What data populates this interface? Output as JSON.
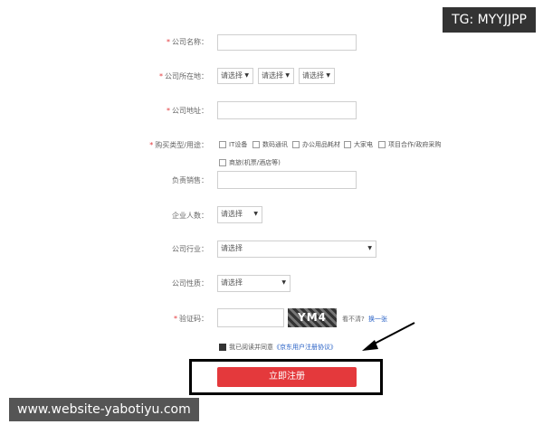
{
  "form": {
    "company_name": {
      "label": "公司名称：",
      "required": true
    },
    "company_location": {
      "label": "公司所在地：",
      "required": true,
      "selects": [
        "请选择",
        "请选择",
        "请选择"
      ]
    },
    "company_address": {
      "label": "公司地址：",
      "required": true
    },
    "purchase_type": {
      "label": "购买类型/用途：",
      "required": true,
      "options": [
        "IT设备",
        "数码通讯",
        "办公用品耗材",
        "大家电",
        "项目合作/政府采购",
        "商旅(机票/酒店等)"
      ]
    },
    "sales_rep": {
      "label": "负责销售：",
      "required": false
    },
    "employee_count": {
      "label": "企业人数：",
      "required": false,
      "select": "请选择"
    },
    "industry": {
      "label": "公司行业：",
      "required": false,
      "select": "请选择"
    },
    "company_nature": {
      "label": "公司性质：",
      "required": false,
      "select": "请选择"
    },
    "captcha": {
      "label": "验证码：",
      "required": true,
      "image_text": "YM4",
      "hint": "看不清?",
      "refresh_link": "换一张"
    },
    "agreement": {
      "text": "我已阅读并同意",
      "link": "《京东用户注册协议》",
      "checked": true
    },
    "submit_label": "立即注册"
  },
  "watermarks": {
    "tg": "TG: MYYJJPP",
    "website": "www.website-yabotiyu.com"
  },
  "icons": {
    "required": "asterisk",
    "caret": "dropdown-caret-icon",
    "checkbox": "checkbox-icon"
  }
}
